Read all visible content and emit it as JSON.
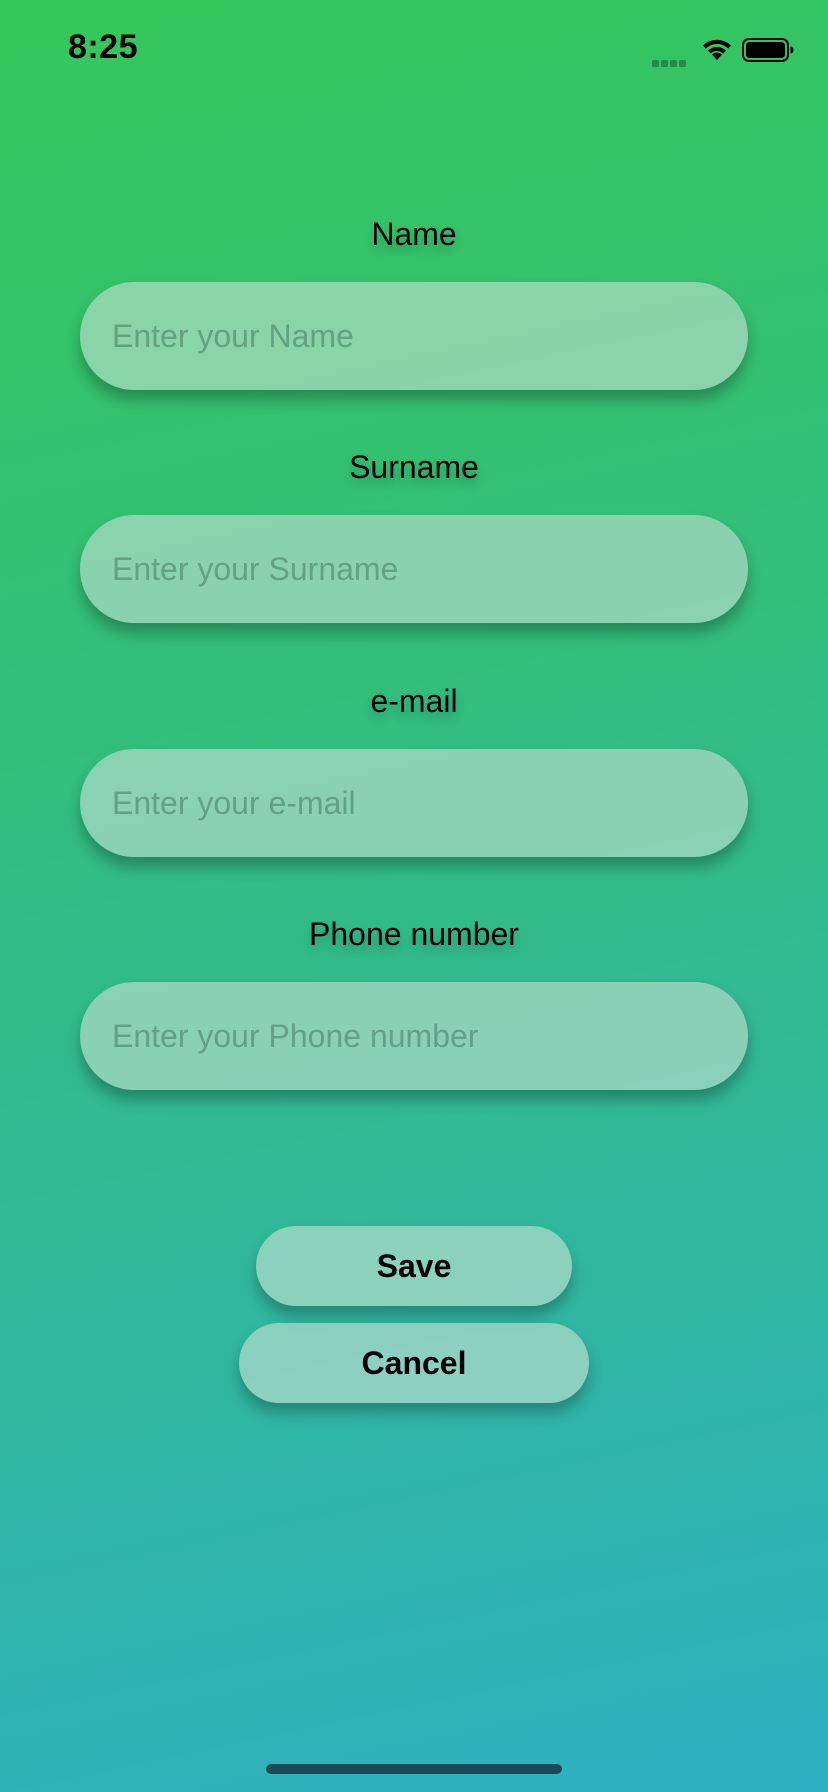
{
  "status_bar": {
    "time": "8:25",
    "icons": [
      "cellular-signal-icon",
      "wifi-icon",
      "battery-icon"
    ]
  },
  "form": {
    "fields": [
      {
        "label": "Name",
        "placeholder": "Enter your Name",
        "value": ""
      },
      {
        "label": "Surname",
        "placeholder": "Enter your Surname",
        "value": ""
      },
      {
        "label": "e-mail",
        "placeholder": "Enter your e-mail",
        "value": ""
      },
      {
        "label": "Phone number",
        "placeholder": "Enter your Phone number",
        "value": ""
      }
    ]
  },
  "actions": {
    "save_label": "Save",
    "cancel_label": "Cancel"
  },
  "colors": {
    "gradient_top": "#35c75a",
    "gradient_bottom": "#2eb0c2",
    "input_fill": "#c4e0d2",
    "text": "#000000"
  }
}
